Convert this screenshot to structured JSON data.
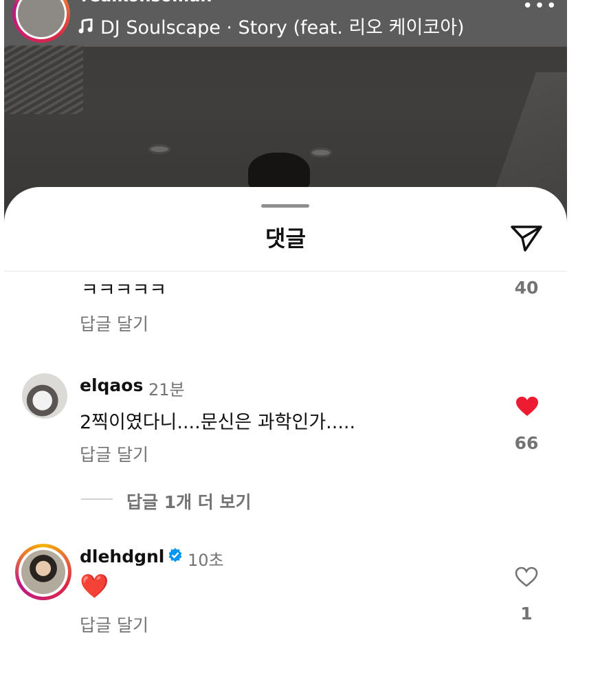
{
  "story": {
    "username": "realkohsoman",
    "music_icon": "music-note-icon",
    "music_text": "DJ Soulscape · Story (feat. 리오 케이코아)",
    "more_icon": "more-horizontal-icon",
    "more_glyph": "•••"
  },
  "sheet": {
    "title": "댓글",
    "share_icon": "paper-plane-icon"
  },
  "comments": [
    {
      "text": "ㅋㅋㅋㅋㅋ",
      "reply_label": "답글 달기",
      "likes": "40"
    },
    {
      "username": "elqaos",
      "time": "21분",
      "text": "2찍이였다니....문신은 과학인가.....",
      "reply_label": "답글 달기",
      "likes": "66",
      "liked": true,
      "more_replies": "답글 1개 더 보기"
    },
    {
      "username": "dlehdgnl",
      "verified": true,
      "time": "10초",
      "text": "❤️",
      "reply_label": "답글 달기",
      "likes": "1",
      "liked": false
    }
  ],
  "colors": {
    "like_red": "#ed1c33",
    "secondary_text": "#737373",
    "verified_blue": "#0095f6"
  }
}
